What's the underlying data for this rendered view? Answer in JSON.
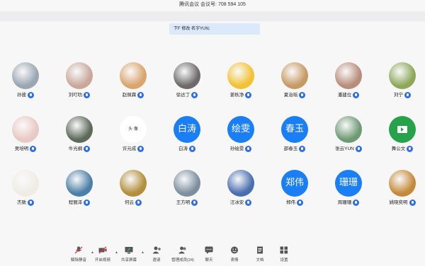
{
  "meeting": {
    "title": "腾讯会议 会议号: 708 594 105"
  },
  "notice": {
    "text": "下F 修改 名字YUN;"
  },
  "participants": [
    {
      "name": "孙彼",
      "avatar": "photo",
      "color": "#9aa6b2"
    },
    {
      "name": "刘叮叻",
      "avatar": "photo",
      "color": "#c9a89b"
    },
    {
      "name": "赵佩霖",
      "avatar": "photo",
      "color": "#d9a56c"
    },
    {
      "name": "徐达丁",
      "avatar": "photo",
      "color": "#6d6a6a"
    },
    {
      "name": "姜秋净",
      "avatar": "photo",
      "color": "#f2c233"
    },
    {
      "name": "夏治瑶",
      "avatar": "photo",
      "color": "#c79a63"
    },
    {
      "name": "潘建位",
      "avatar": "photo",
      "color": "#b88d7a"
    },
    {
      "name": "刘宁",
      "avatar": "photo",
      "color": "#8ea85a"
    },
    {
      "name": "吴培明",
      "avatar": "photo",
      "color": "#e8c9c4"
    },
    {
      "name": "牛光纲",
      "avatar": "photo",
      "color": "#5d6a5a"
    },
    {
      "name": "许元成",
      "avatar": "white",
      "text": "头 像"
    },
    {
      "name": "白涛",
      "avatar": "text",
      "text": "白涛"
    },
    {
      "name": "孙绘雯",
      "avatar": "text",
      "text": "绘雯"
    },
    {
      "name": "邵春玉",
      "avatar": "text",
      "text": "春玉"
    },
    {
      "name": "张云YUN",
      "avatar": "photo",
      "color": "#6f9a74"
    },
    {
      "name": "舞公文",
      "avatar": "folder"
    },
    {
      "name": "杰致",
      "avatar": "photo",
      "color": "#f0ece4"
    },
    {
      "name": "程丽泽",
      "avatar": "photo",
      "color": "#4c7fa8"
    },
    {
      "name": "何云",
      "avatar": "photo",
      "color": "#b38f3c"
    },
    {
      "name": "王方明",
      "avatar": "photo",
      "color": "#7d8f9e"
    },
    {
      "name": "汪冰安",
      "avatar": "photo",
      "color": "#4a6fb0"
    },
    {
      "name": "郑伟",
      "avatar": "text",
      "text": "郑伟"
    },
    {
      "name": "周珊珊",
      "avatar": "text",
      "text": "珊珊"
    },
    {
      "name": "姚晓奕明",
      "avatar": "photo",
      "color": "#c48a3a"
    }
  ],
  "toolbar": {
    "items": [
      {
        "label": "解除静音",
        "icon": "mic-muted-icon"
      },
      {
        "label": "开启视频",
        "icon": "video-off-icon"
      },
      {
        "label": "共享屏幕",
        "icon": "screen-share-icon"
      },
      {
        "label": "邀请",
        "icon": "invite-icon"
      },
      {
        "label": "管理成员(24)",
        "icon": "members-icon"
      },
      {
        "label": "聊天",
        "icon": "chat-icon"
      },
      {
        "label": "表情",
        "icon": "emoji-icon"
      },
      {
        "label": "文档",
        "icon": "document-icon"
      },
      {
        "label": "设置",
        "icon": "settings-icon"
      }
    ]
  }
}
